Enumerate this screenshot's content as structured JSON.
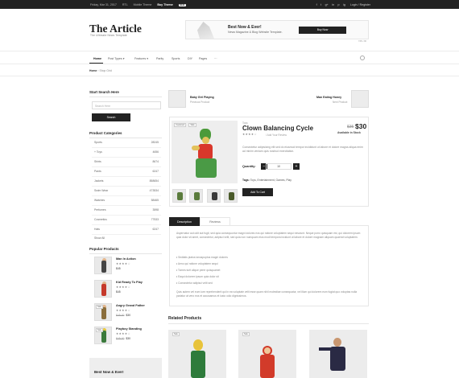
{
  "topbar": {
    "date": "Friday, Mar 31, 2017",
    "rtl": "RTL",
    "mobile": "Mobile Theme",
    "buy": "Buy Theme",
    "badge": "NEW",
    "social": [
      "f",
      "t",
      "g+",
      "in",
      "p",
      "ig"
    ],
    "login": "Login / Register"
  },
  "logo": {
    "title": "The Article",
    "subtitle": "The Ultimate News Template"
  },
  "ad": {
    "headline": "Best Now & Ever!",
    "sub": "News Magazine & Blog Website Template.",
    "button": "Buy Now",
    "size": "728 x 90"
  },
  "nav": {
    "items": [
      "Home",
      "Post Types",
      "Features",
      "Parity",
      "Sports",
      "DIY",
      "Pages",
      "···"
    ]
  },
  "breadcrumb": {
    "home": "Home",
    "current": "Shop Grid"
  },
  "sidebar": {
    "search_title": "Start Search Here",
    "search_placeholder": "Search Here",
    "search_button": "Search",
    "categories_title": "Product Categories",
    "categories": [
      {
        "name": "Sports",
        "count": "28245"
      },
      {
        "name": "+ Toys",
        "count": "4656"
      },
      {
        "name": "Shirts",
        "count": "8674"
      },
      {
        "name": "Pants",
        "count": "6247"
      },
      {
        "name": "Jackets",
        "count": "858654"
      },
      {
        "name": "Swim Wear",
        "count": "473534"
      },
      {
        "name": "Watches",
        "count": "58465"
      },
      {
        "name": "Perfumes",
        "count": "3598"
      },
      {
        "name": "Cosmetics",
        "count": "77533"
      },
      {
        "name": "Hats",
        "count": "6247"
      },
      {
        "name": "Show All",
        "count": ""
      }
    ],
    "popular_title": "Popular Products",
    "popular": [
      {
        "name": "Man In Action",
        "stars": "★★★★☆",
        "old": "",
        "price": "$45",
        "sale": ""
      },
      {
        "name": "Kid Ready To Play",
        "stars": "★★★★☆",
        "old": "",
        "price": "$45",
        "sale": ""
      },
      {
        "name": "Angry Grand Father",
        "stars": "★★★★☆",
        "old": "$45.00",
        "price": "$30",
        "sale": "Sale"
      },
      {
        "name": "Playboy Standing",
        "stars": "★★★★☆",
        "old": "$45.00",
        "price": "$30",
        "sale": "Sale"
      }
    ],
    "banner": "Best Now & Ever!"
  },
  "prevnext": {
    "prev_name": "Baby Girl Playing",
    "prev_label": "Previous Product",
    "next_name": "Man Eating Honey",
    "next_label": "Next Product"
  },
  "product": {
    "flags": [
      "Featured",
      "Sale"
    ],
    "tag": "Toys",
    "title": "Clown Balancing Cycle",
    "stars": "★★★★☆",
    "review": "Add Your Review",
    "old_price": "$35",
    "price": "$30",
    "availability": "Available in Stock",
    "description": "Consectetur adipisicing elit sed do eiusmod tempor incididunt ut labore et dolore magna aliqua enim ad minim veniam quis nostrud exercitation.",
    "qty_label": "Quantity:",
    "qty_value": "10",
    "minus": "−",
    "plus": "+",
    "tags_label": "Tags:",
    "tags": "Toys, Entertainment, Games, Play",
    "cart": "Add To Cart"
  },
  "tabs": {
    "description": "Description",
    "reviews": "Reviews"
  },
  "description": {
    "p1": "Aspernatur aut odit aut fugit, sed quia consequuntur magni dolores eos qui ratione voluptatem sequi nesciunt. Neque porro quisquam est, qui dolorem ipsum quia dolor sit amet, consectetur, adipisci velit, sed quia non numquam eius modi tempora incidunt ut labore et dolore magnam aliquam quaerat voluptatem.",
    "bullets": [
      "Sedlatis piatus ianuspuptus magni dolores",
      "Aeno qui ratione voluptatem sequi",
      "Tomes turit alique perer quisquamet",
      "Eaqui dolorem ipsum quia dolor sit",
      "Consectetur adipisci velit sed"
    ],
    "p2": "Quis autem vel eum iure reprehenderit qui in ea voluptate velit esse quam nihil molestiae consequatur, vel illum qui dolorem eum fugiat quo voluptas nulla pariatur at vero eos et accusamus et iusto odio dignissimos."
  },
  "related": {
    "title": "Related Products",
    "sale": "Sale"
  }
}
